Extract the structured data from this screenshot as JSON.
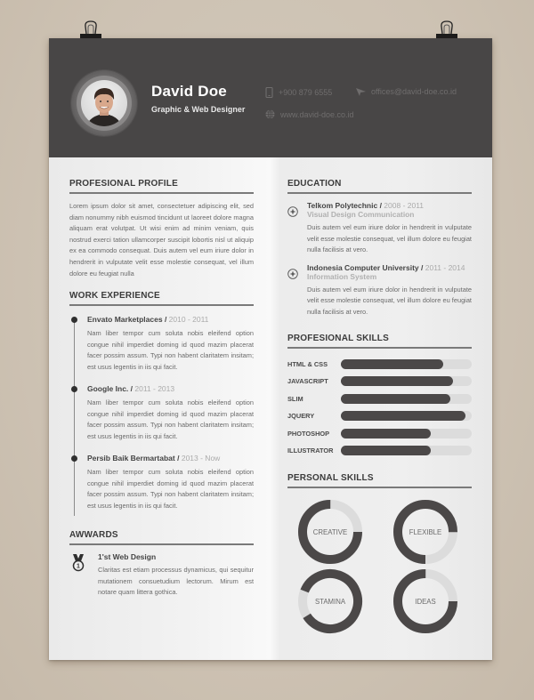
{
  "header": {
    "name": "David Doe",
    "title": "Graphic & Web Designer",
    "phone": "+900 879 6555",
    "email": "offices@david-doe.co.id",
    "website": "www.david-doe.co.id",
    "icons": {
      "phone": "mobile-phone-icon",
      "email": "paper-plane-icon",
      "website": "globe-icon"
    }
  },
  "profile": {
    "heading": "PROFESIONAL PROFILE",
    "text": "Lorem ipsum dolor sit amet, consectetuer adipiscing elit, sed diam nonummy nibh euismod tincidunt ut laoreet dolore magna aliquam erat volutpat. Ut wisi enim ad minim veniam, quis nostrud exerci tation ullamcorper suscipit lobortis nisl ut aliquip ex ea commodo consequat. Duis autem vel eum iriure dolor in hendrerit in vulputate velit esse molestie consequat, vel illum dolore eu feugiat nulla"
  },
  "work": {
    "heading": "WORK EXPERIENCE",
    "items": [
      {
        "company": "Envato Marketplaces",
        "sep": " / ",
        "years": "2010 - 2011",
        "text": "Nam liber tempor cum soluta nobis eleifend option congue nihil imperdiet doming id quod mazim placerat facer possim assum. Typi non habent claritatem insitam; est usus legentis in iis qui facit."
      },
      {
        "company": "Google Inc.",
        "sep": " / ",
        "years": "2011 - 2013",
        "text": "Nam liber tempor cum soluta nobis eleifend option congue nihil imperdiet doming id quod mazim placerat facer possim assum. Typi non habent claritatem insitam; est usus legentis in iis qui facit."
      },
      {
        "company": "Persib Baik Bermartabat",
        "sep": " / ",
        "years": "2013 - Now",
        "text": "Nam liber tempor cum soluta nobis eleifend option congue nihil imperdiet doming id quod mazim placerat facer possim assum. Typi non habent claritatem insitam; est usus legentis in iis qui facit."
      }
    ]
  },
  "awards": {
    "heading": "AWWARDS",
    "items": [
      {
        "title": "1'st Web Design",
        "icon": "medal-icon",
        "text": "Claritas est etiam processus dynamicus, qui sequitur mutationem consuetudium lectorum. Mirum est notare quam littera gothica."
      }
    ]
  },
  "education": {
    "heading": "EDUCATION",
    "items": [
      {
        "school": "Telkom Polytechnic",
        "sep": " / ",
        "years": "2008 - 2011",
        "major": "Visual Design Communication",
        "text": "Duis autem vel eum iriure dolor in hendrerit in vulputate velit esse molestie consequat, vel illum dolore eu feugiat nulla facilisis at vero."
      },
      {
        "school": "Indonesia Computer University",
        "sep": " / ",
        "years": "2011 - 2014",
        "major": "Information System",
        "text": "Duis autem vel eum iriure dolor in hendrerit in vulputate velit esse molestie consequat, vel illum dolore eu feugiat nulla facilisis at vero."
      }
    ]
  },
  "skills": {
    "heading": "PROFESIONAL SKILLS",
    "items": [
      {
        "label": "HTML & CSS",
        "percent": 78
      },
      {
        "label": "JAVASCRIPT",
        "percent": 86
      },
      {
        "label": "SLIM",
        "percent": 84
      },
      {
        "label": "JQUERY",
        "percent": 95
      },
      {
        "label": "PHOTOSHOP",
        "percent": 69
      },
      {
        "label": "ILLUSTRATOR",
        "percent": 69
      }
    ]
  },
  "personal_skills": {
    "heading": "PERSONAL SKILLS",
    "items": [
      {
        "label": "CREATIVE",
        "percent": 75,
        "gap_start": 0
      },
      {
        "label": "FLEXIBLE",
        "percent": 75,
        "gap_start": 0.25
      },
      {
        "label": "STAMINA",
        "percent": 85,
        "gap_start": 0.66
      },
      {
        "label": "IDEAS",
        "percent": 75,
        "gap_start": 0
      }
    ]
  },
  "colors": {
    "header_bg": "#484646",
    "accent_dark": "#4b4848",
    "track_light": "#dcdcdc",
    "background": "#cec3b4"
  }
}
